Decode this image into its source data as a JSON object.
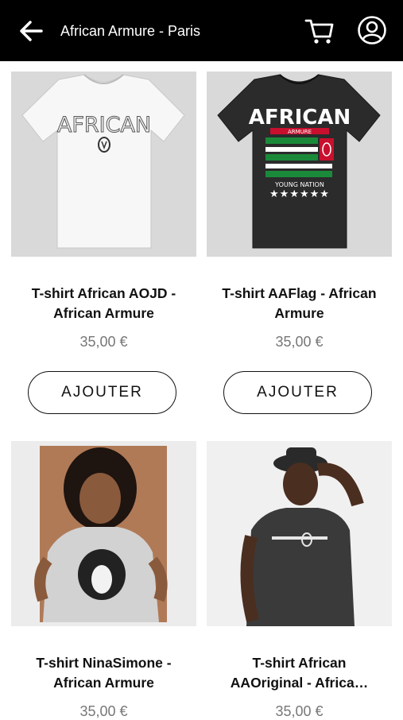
{
  "header": {
    "title": "African Armure - Paris",
    "bg_color": "#000000"
  },
  "products": [
    {
      "name_line1": "T-shirt African AOJD -",
      "name_line2": "African Armure",
      "price": "35,00 €",
      "button_label": "AJOUTER",
      "shirt_text": "AFRICAN"
    },
    {
      "name_line1": "T-shirt AAFlag - African",
      "name_line2": "Armure",
      "price": "35,00 €",
      "button_label": "AJOUTER",
      "shirt_text": "AFRICAN",
      "shirt_subtext": "ARMURE",
      "shirt_tagline": "YOUNG NATION"
    },
    {
      "name_line1": "T-shirt NinaSimone -",
      "name_line2": "African Armure",
      "price": "35,00 €"
    },
    {
      "name_line1": "T-shirt African",
      "name_line2": "AAOriginal - Africa…",
      "price": "35,00 €"
    }
  ],
  "icons": {
    "back": "arrow-left-icon",
    "cart": "shopping-cart-icon",
    "user": "user-account-icon"
  }
}
